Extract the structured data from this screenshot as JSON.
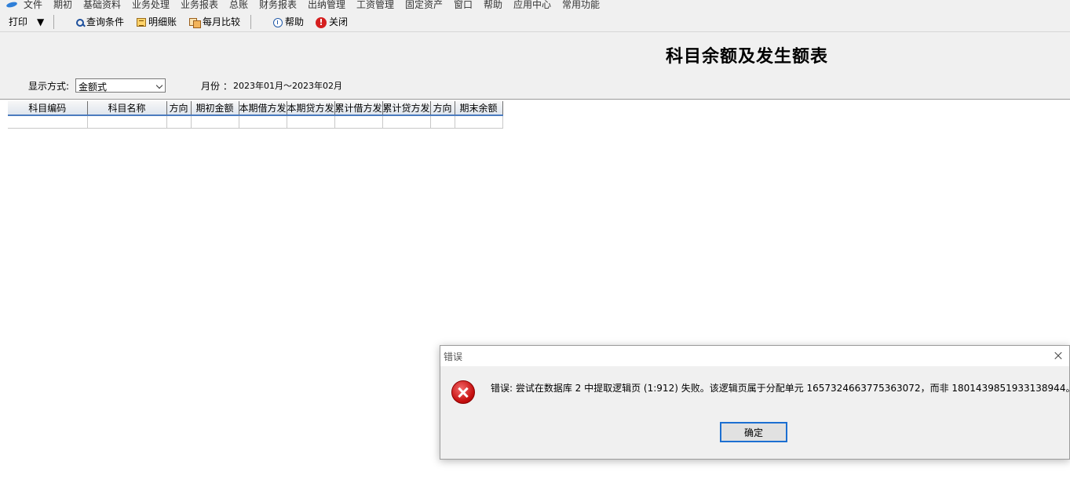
{
  "menubar": {
    "items": [
      "文件",
      "期初",
      "基础资料",
      "业务处理",
      "业务报表",
      "总账",
      "财务报表",
      "出纳管理",
      "工资管理",
      "固定资产",
      "窗口",
      "帮助",
      "应用中心",
      "常用功能"
    ]
  },
  "toolbar": {
    "print": "打印",
    "print_dropdown": "▼",
    "query": "查询条件",
    "detail": "明细账",
    "monthly_compare": "每月比较",
    "help": "帮助",
    "close": "关闭"
  },
  "report": {
    "title": "科目余额及发生额表",
    "display_label": "显示方式:",
    "display_value": "金额式",
    "month_label": "月份 ：",
    "month_value": "2023年01月～2023年02月"
  },
  "grid": {
    "columns": [
      "科目编码",
      "科目名称",
      "方向",
      "期初金额",
      "本期借方发",
      "本期贷方发",
      "累计借方发",
      "累计贷方发",
      "方向",
      "期末余额"
    ]
  },
  "dialog": {
    "title": "错误",
    "message": "错误: 尝试在数据库 2 中提取逻辑页 (1:912) 失败。该逻辑页属于分配单元 1657324663775363072，而非 1801439851933138944。",
    "ok_label": "确定"
  }
}
